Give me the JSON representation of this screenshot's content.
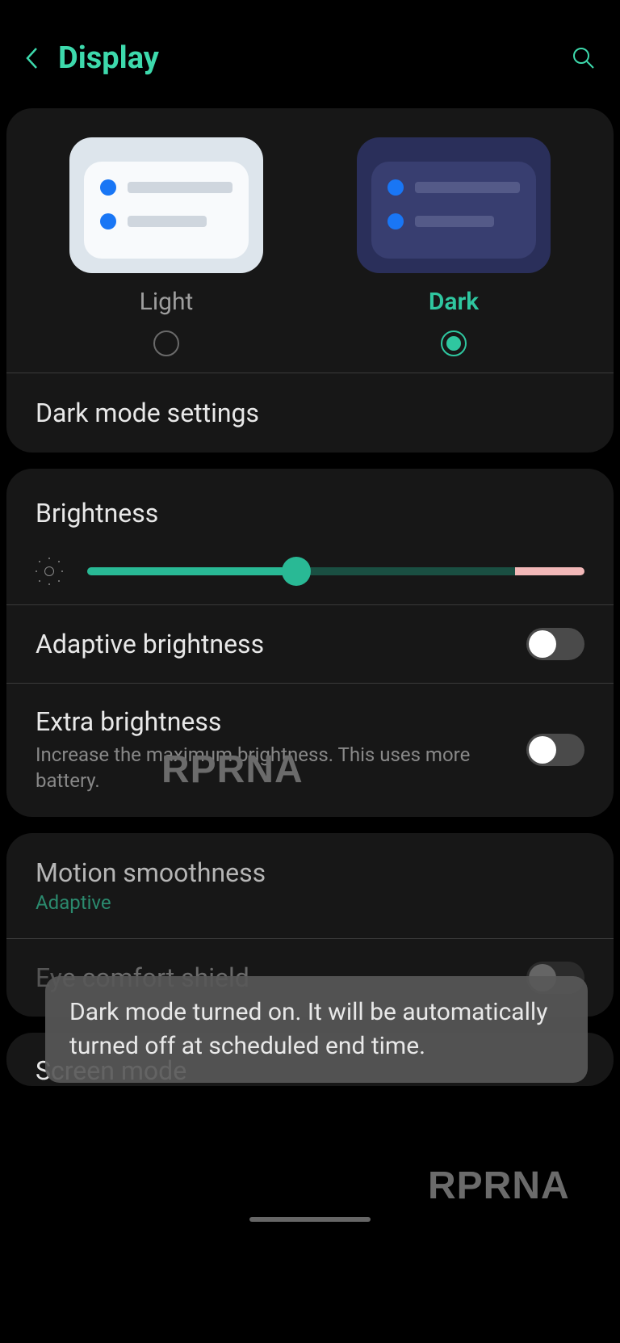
{
  "header": {
    "title": "Display"
  },
  "theme": {
    "light_label": "Light",
    "dark_label": "Dark",
    "selected": "dark"
  },
  "dark_mode_settings_label": "Dark mode settings",
  "brightness": {
    "title": "Brightness",
    "value_percent": 42
  },
  "adaptive_brightness": {
    "title": "Adaptive brightness",
    "enabled": false
  },
  "extra_brightness": {
    "title": "Extra brightness",
    "subtitle": "Increase the maximum brightness. This uses more battery.",
    "enabled": false
  },
  "motion_smoothness": {
    "title": "Motion smoothness",
    "subtitle": "Adaptive"
  },
  "eye_comfort": {
    "title": "Eye comfort shield",
    "enabled": false
  },
  "screen_mode": {
    "title": "Screen mode"
  },
  "toast": {
    "message": "Dark mode turned on. It will be automatically turned off at scheduled end time."
  },
  "watermark": "RPRNA"
}
